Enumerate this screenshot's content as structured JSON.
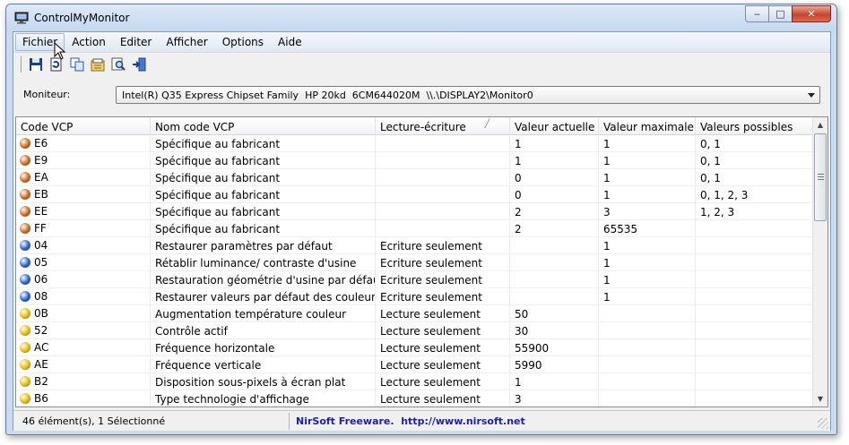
{
  "window": {
    "title": "ControlMyMonitor"
  },
  "menu": [
    "Fichier",
    "Action",
    "Editer",
    "Afficher",
    "Options",
    "Aide"
  ],
  "toolbar": [
    "save-icon",
    "refresh-icon",
    "copy-icon",
    "properties-icon",
    "find-icon",
    "exit-icon"
  ],
  "monitor": {
    "label": "Moniteur:",
    "value": "Intel(R) Q35 Express Chipset Family  HP 20kd  6CM644020M  \\\\.\\DISPLAY2\\Monitor0"
  },
  "columns": [
    "Code VCP",
    "Nom code VCP",
    "Lecture-écriture",
    "Valeur actuelle",
    "Valeur maximale",
    "Valeurs possibles"
  ],
  "colors": {
    "orange": "#c9671c",
    "blue": "#1f5fcf",
    "yellow": "#e8b800"
  },
  "rows": [
    {
      "code": "E6",
      "dot": "orange",
      "name": "Spécifique au fabricant",
      "rw": "",
      "cur": "1",
      "max": "1",
      "possible": "0, 1"
    },
    {
      "code": "E9",
      "dot": "orange",
      "name": "Spécifique au fabricant",
      "rw": "",
      "cur": "1",
      "max": "1",
      "possible": "0, 1"
    },
    {
      "code": "EA",
      "dot": "orange",
      "name": "Spécifique au fabricant",
      "rw": "",
      "cur": "0",
      "max": "1",
      "possible": "0, 1"
    },
    {
      "code": "EB",
      "dot": "orange",
      "name": "Spécifique au fabricant",
      "rw": "",
      "cur": "0",
      "max": "1",
      "possible": "0, 1, 2, 3"
    },
    {
      "code": "EE",
      "dot": "orange",
      "name": "Spécifique au fabricant",
      "rw": "",
      "cur": "2",
      "max": "3",
      "possible": "1, 2, 3"
    },
    {
      "code": "FF",
      "dot": "orange",
      "name": "Spécifique au fabricant",
      "rw": "",
      "cur": "2",
      "max": "65535",
      "possible": ""
    },
    {
      "code": "04",
      "dot": "blue",
      "name": "Restaurer paramètres par défaut",
      "rw": "Ecriture seulement",
      "cur": "",
      "max": "1",
      "possible": ""
    },
    {
      "code": "05",
      "dot": "blue",
      "name": "Rétablir luminance/ contraste d'usine",
      "rw": "Ecriture seulement",
      "cur": "",
      "max": "1",
      "possible": ""
    },
    {
      "code": "06",
      "dot": "blue",
      "name": "Restauration géométrie d'usine par défaut",
      "rw": "Ecriture seulement",
      "cur": "",
      "max": "1",
      "possible": ""
    },
    {
      "code": "08",
      "dot": "blue",
      "name": "Restaurer valeurs par défaut des couleurs d'...",
      "rw": "Ecriture seulement",
      "cur": "",
      "max": "1",
      "possible": ""
    },
    {
      "code": "0B",
      "dot": "yellow",
      "name": "Augmentation température couleur",
      "rw": "Lecture seulement",
      "cur": "50",
      "max": "",
      "possible": ""
    },
    {
      "code": "52",
      "dot": "yellow",
      "name": "Contrôle actif",
      "rw": "Lecture seulement",
      "cur": "30",
      "max": "",
      "possible": ""
    },
    {
      "code": "AC",
      "dot": "yellow",
      "name": "Fréquence horizontale",
      "rw": "Lecture seulement",
      "cur": "55900",
      "max": "",
      "possible": ""
    },
    {
      "code": "AE",
      "dot": "yellow",
      "name": "Fréquence verticale",
      "rw": "Lecture seulement",
      "cur": "5990",
      "max": "",
      "possible": ""
    },
    {
      "code": "B2",
      "dot": "yellow",
      "name": "Disposition sous-pixels à écran plat",
      "rw": "Lecture seulement",
      "cur": "1",
      "max": "",
      "possible": ""
    },
    {
      "code": "B6",
      "dot": "yellow",
      "name": "Type technologie d'affichage",
      "rw": "Lecture seulement",
      "cur": "3",
      "max": "",
      "possible": ""
    }
  ],
  "status": {
    "count": "46 élément(s), 1 Sélectionné",
    "credit": "NirSoft Freeware.  http://www.nirsoft.net"
  }
}
